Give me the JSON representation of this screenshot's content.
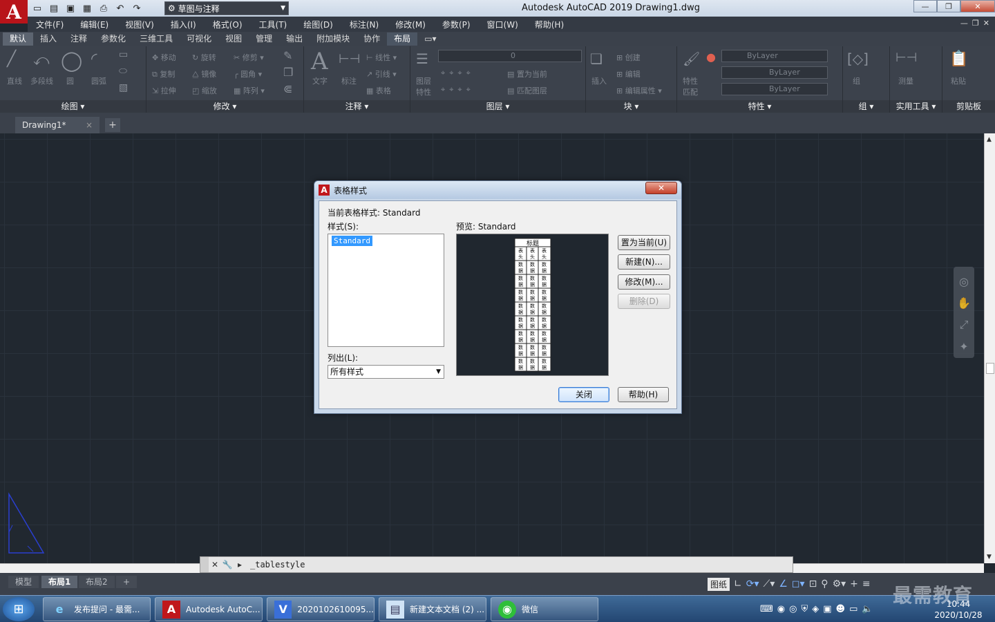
{
  "app": {
    "title": "Autodesk AutoCAD 2019    Drawing1.dwg",
    "logo_letter": "A",
    "workspace": "草图与注释"
  },
  "menu": [
    "文件(F)",
    "编辑(E)",
    "视图(V)",
    "插入(I)",
    "格式(O)",
    "工具(T)",
    "绘图(D)",
    "标注(N)",
    "修改(M)",
    "参数(P)",
    "窗口(W)",
    "帮助(H)"
  ],
  "ribbon_tabs": [
    "默认",
    "插入",
    "注释",
    "参数化",
    "三维工具",
    "可视化",
    "视图",
    "管理",
    "输出",
    "附加模块",
    "协作",
    "布局"
  ],
  "ribbon": {
    "draw": {
      "title": "绘图",
      "tools": [
        "直线",
        "多段线",
        "圆",
        "圆弧"
      ]
    },
    "modify": {
      "title": "修改",
      "tools": [
        "移动",
        "旋转",
        "修剪",
        "复制",
        "镜像",
        "圆角",
        "拉伸",
        "缩放",
        "阵列"
      ]
    },
    "annotation": {
      "title": "注释",
      "tools": [
        "文字",
        "标注",
        "线性",
        "引线",
        "表格"
      ]
    },
    "layers": {
      "title": "图层",
      "tools": [
        "图层特性",
        "置为当前",
        "匹配图层"
      ],
      "layer_value": "0"
    },
    "block": {
      "title": "块",
      "tools": [
        "插入",
        "创建",
        "编辑",
        "编辑属性"
      ]
    },
    "properties": {
      "title": "特性",
      "tools": [
        "特性匹配"
      ],
      "fields": [
        "ByLayer",
        "ByLayer",
        "ByLayer"
      ]
    },
    "groups": {
      "title": "组",
      "tools": [
        "组"
      ]
    },
    "utilities": {
      "title": "实用工具",
      "tools": [
        "测量"
      ]
    },
    "clipboard": {
      "title": "剪贴板",
      "tools": [
        "粘贴"
      ]
    }
  },
  "doc_tab": {
    "name": "Drawing1*",
    "close": "×",
    "new": "+"
  },
  "command_line": {
    "text": "_tablestyle"
  },
  "layout_tabs": [
    "模型",
    "布局1",
    "布局2"
  ],
  "status": {
    "paper": "图纸"
  },
  "dialog": {
    "title": "表格样式",
    "close": "✕",
    "current_label": "当前表格样式: Standard",
    "styles_label": "样式(S):",
    "styles": [
      "Standard"
    ],
    "preview_label": "预览: Standard",
    "list_label": "列出(L):",
    "list_value": "所有样式",
    "buttons": {
      "set_current": "置为当前(U)",
      "new": "新建(N)...",
      "modify": "修改(M)...",
      "delete": "删除(D)",
      "close": "关闭",
      "help": "帮助(H)"
    },
    "preview_table": {
      "title": "标题",
      "header": "表头",
      "cell": "数据"
    }
  },
  "taskbar": {
    "items": [
      "发布提问 - 最需...",
      "Autodesk AutoC...",
      "2020102610095...",
      "新建文本文档 (2) ...",
      "微信"
    ],
    "clock_time": "10:44",
    "clock_date": "2020/10/28"
  },
  "watermark": "最需教育"
}
